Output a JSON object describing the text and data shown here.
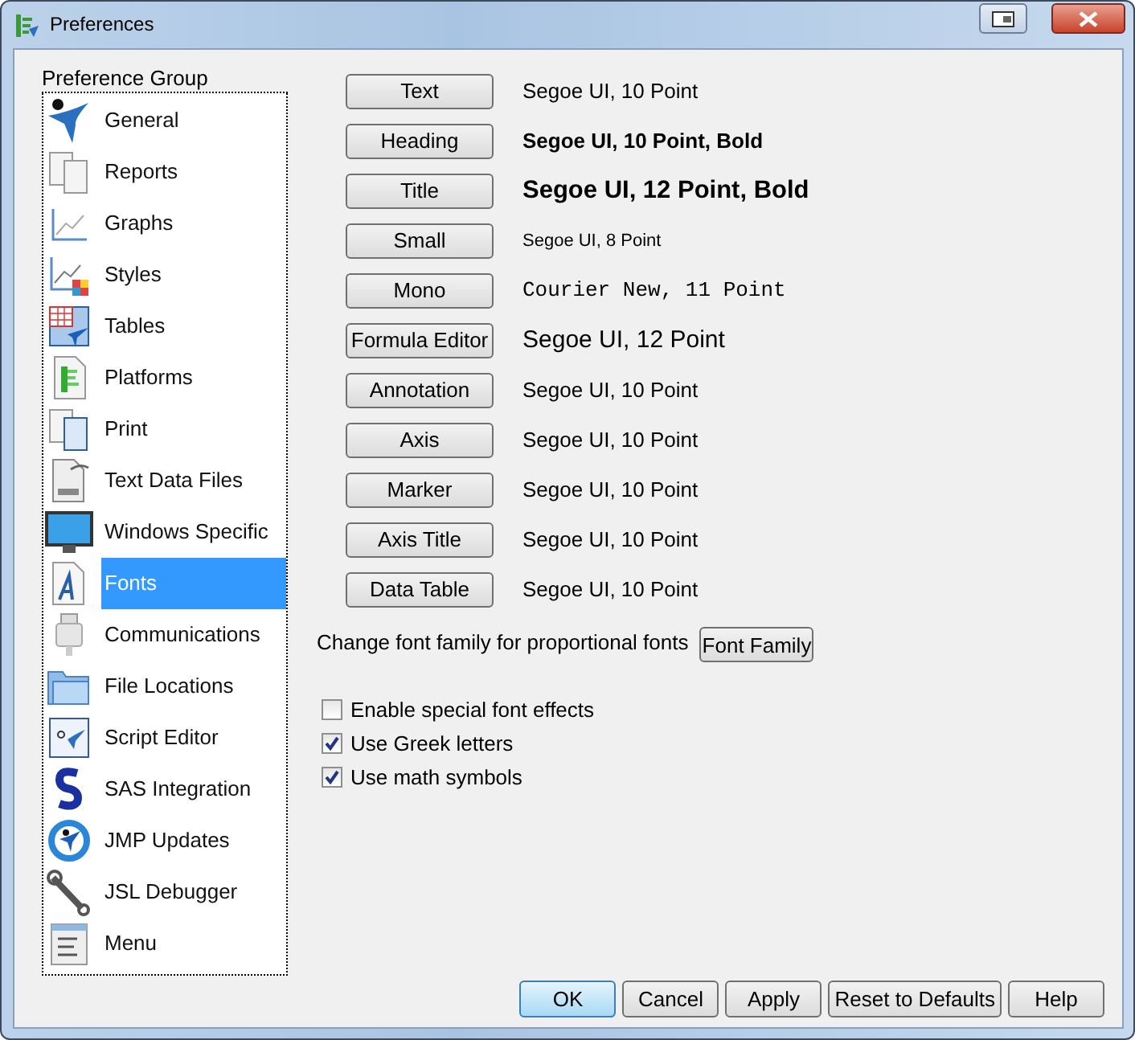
{
  "window": {
    "title": "Preferences"
  },
  "preference_group": {
    "label": "Preference Group",
    "items": [
      {
        "label": "General",
        "selected": false
      },
      {
        "label": "Reports",
        "selected": false
      },
      {
        "label": "Graphs",
        "selected": false
      },
      {
        "label": "Styles",
        "selected": false
      },
      {
        "label": "Tables",
        "selected": false
      },
      {
        "label": "Platforms",
        "selected": false
      },
      {
        "label": "Print",
        "selected": false
      },
      {
        "label": "Text Data Files",
        "selected": false
      },
      {
        "label": "Windows Specific",
        "selected": false
      },
      {
        "label": "Fonts",
        "selected": true
      },
      {
        "label": "Communications",
        "selected": false
      },
      {
        "label": "File Locations",
        "selected": false
      },
      {
        "label": "Script Editor",
        "selected": false
      },
      {
        "label": "SAS Integration",
        "selected": false
      },
      {
        "label": "JMP Updates",
        "selected": false
      },
      {
        "label": "JSL Debugger",
        "selected": false
      },
      {
        "label": "Menu",
        "selected": false
      }
    ]
  },
  "fonts": [
    {
      "button": "Text",
      "sample": "Segoe UI, 10 Point",
      "kind": "normal"
    },
    {
      "button": "Heading",
      "sample": "Segoe UI, 10 Point, Bold",
      "kind": "bold"
    },
    {
      "button": "Title",
      "sample": "Segoe UI, 12 Point, Bold",
      "kind": "largebold"
    },
    {
      "button": "Small",
      "sample": "Segoe UI, 8 Point",
      "kind": "small"
    },
    {
      "button": "Mono",
      "sample": "Courier New, 11 Point",
      "kind": "mono"
    },
    {
      "button": "Formula Editor",
      "sample": "Segoe UI, 12 Point",
      "kind": "large"
    },
    {
      "button": "Annotation",
      "sample": "Segoe UI, 10 Point",
      "kind": "normal"
    },
    {
      "button": "Axis",
      "sample": "Segoe UI, 10 Point",
      "kind": "normal"
    },
    {
      "button": "Marker",
      "sample": "Segoe UI, 10 Point",
      "kind": "normal"
    },
    {
      "button": "Axis Title",
      "sample": "Segoe UI, 10 Point",
      "kind": "normal"
    },
    {
      "button": "Data Table",
      "sample": "Segoe UI, 10 Point",
      "kind": "normal"
    }
  ],
  "font_family": {
    "label": "Change font family for proportional fonts",
    "button": "Font Family"
  },
  "options": [
    {
      "label": "Enable special font effects",
      "checked": false
    },
    {
      "label": "Use Greek letters",
      "checked": true
    },
    {
      "label": "Use math symbols",
      "checked": true
    }
  ],
  "buttons": [
    "OK",
    "Cancel",
    "Apply",
    "Reset to Defaults",
    "Help"
  ]
}
